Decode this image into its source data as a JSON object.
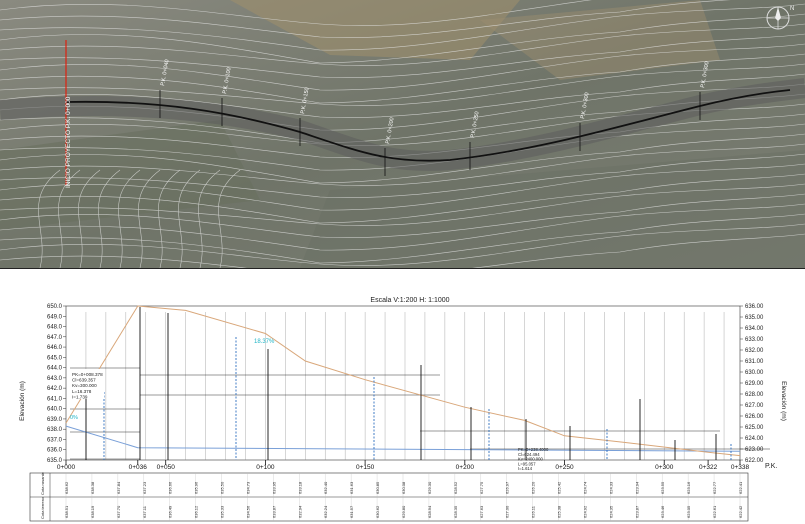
{
  "plan": {
    "alignment_label": "INICIO PROYECTO P.K. 0+000",
    "station_labels": [
      "P.K. 0+040",
      "P.K. 0+100",
      "P.K. 0+150",
      "P.K. 0+200",
      "P.K. 0+250",
      "P.K. 0+300"
    ],
    "compass_label": "N"
  },
  "profile": {
    "scale_title": "Escala V:1:200 H: 1:1000",
    "left_axis_label": "Elevación (m)",
    "right_axis_label": "Elevación (m)",
    "grade_label": "18.37%",
    "left_grade_label": "0%",
    "pk_label": "P.K.",
    "curve_annotation": [
      "PK=0+008.378",
      "Cl=639.357",
      "Kv=300.000",
      "L=16.378",
      "I=1.739"
    ],
    "curve_annotation_right": [
      "PK=0+238.4000",
      "Cl=624.494",
      "Kv=2400.000",
      "L=95.057",
      "I=1.614"
    ]
  },
  "chart_data": {
    "type": "line",
    "left_axis": {
      "ticks": [
        "650.0",
        "649.0",
        "648.0",
        "647.0",
        "646.0",
        "645.0",
        "644.0",
        "643.0",
        "642.0",
        "641.0",
        "640.0",
        "639.0",
        "638.0",
        "637.0",
        "636.0",
        "635.0"
      ],
      "ylim": [
        635.0,
        650.0
      ]
    },
    "right_axis": {
      "ticks": [
        "636.00",
        "635.00",
        "634.00",
        "633.00",
        "632.00",
        "631.00",
        "630.00",
        "629.00",
        "628.00",
        "627.00",
        "626.00",
        "625.00",
        "624.00",
        "623.00",
        "622.00"
      ],
      "ylim": [
        622.0,
        636.0
      ]
    },
    "x_ticks": [
      "0+000",
      "0+036",
      "0+050",
      "0+100",
      "0+150",
      "0+200",
      "0+250",
      "0+300",
      "0+322",
      "0+338"
    ],
    "x_range": [
      0,
      338
    ],
    "series": [
      {
        "name": "",
        "color": "#7aa0d8",
        "x": [
          0,
          36,
          338
        ],
        "y": [
          638.3,
          636.2,
          622.8
        ]
      },
      {
        "name": "",
        "color": "#d9a77a",
        "x": [
          0,
          36,
          60,
          100,
          120,
          150,
          200,
          230,
          250,
          280,
          322,
          338
        ],
        "y": [
          638.6,
          636.0,
          635.6,
          633.5,
          631.0,
          629.3,
          626.8,
          625.6,
          624.2,
          623.6,
          622.7,
          622.4
        ]
      }
    ]
  },
  "guitar": {
    "row1_label": "Cota rasante",
    "row2_label": "Cota terreno",
    "row1_values": [
      "638.62",
      "638.38",
      "637.84",
      "637.23",
      "636.66",
      "635.96",
      "635.50",
      "634.73",
      "633.95",
      "633.18",
      "632.40",
      "631.63",
      "630.85",
      "630.08",
      "629.30",
      "628.52",
      "627.75",
      "626.97",
      "626.20",
      "625.42",
      "624.74",
      "624.33",
      "623.94",
      "623.55",
      "623.16",
      "622.77",
      "622.41"
    ],
    "row2_values": [
      "638.51",
      "638.19",
      "637.70",
      "637.11",
      "636.49",
      "636.12",
      "635.33",
      "634.56",
      "633.87",
      "632.94",
      "632.24",
      "631.57",
      "630.62",
      "629.80",
      "628.94",
      "628.35",
      "627.63",
      "627.00",
      "626.11",
      "625.38",
      "624.92",
      "624.35",
      "623.87",
      "623.46",
      "623.05",
      "622.61",
      "622.42"
    ]
  }
}
